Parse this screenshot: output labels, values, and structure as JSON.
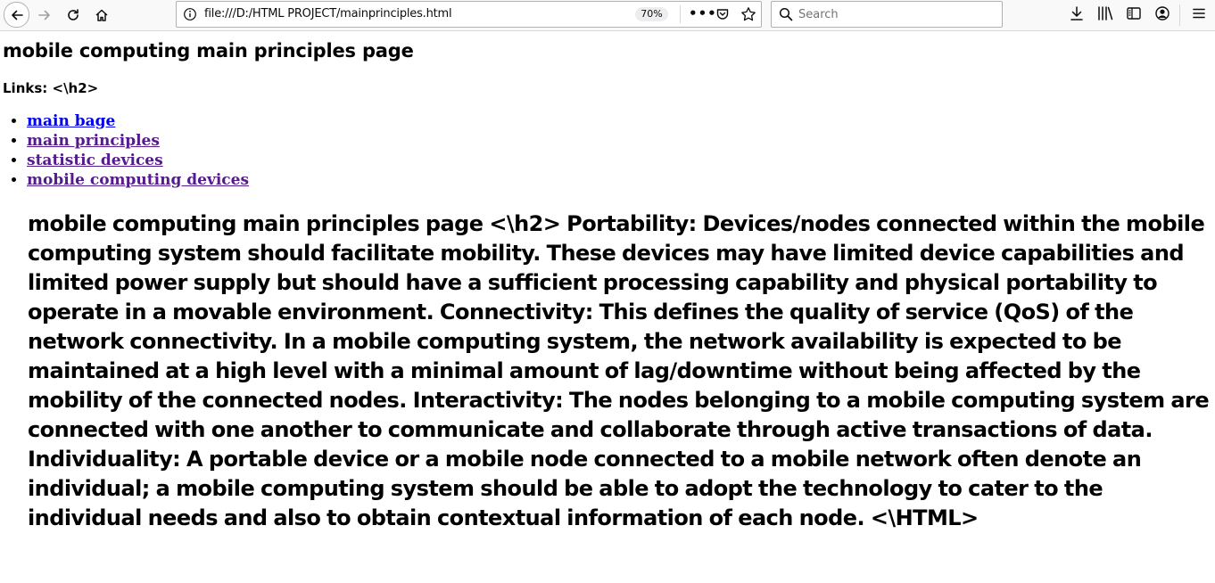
{
  "browser": {
    "url": "file:///D:/HTML PROJECT/mainprinciples.html",
    "zoom": "70%",
    "search_placeholder": "Search",
    "icons": {
      "back": "back-arrow-icon",
      "forward": "forward-arrow-icon",
      "reload": "reload-icon",
      "home": "home-icon",
      "info": "info-icon",
      "more": "more-icon",
      "pocket": "pocket-icon",
      "bookmark": "star-icon",
      "search": "search-icon",
      "download": "download-icon",
      "library": "library-icon",
      "sidebar": "sidebar-icon",
      "account": "account-icon",
      "menu": "hamburger-menu-icon"
    }
  },
  "page": {
    "heading": "mobile computing main principles page",
    "links_label": "Links: <\\h2>",
    "links": [
      {
        "label": "main bage",
        "visited": false
      },
      {
        "label": "main principles",
        "visited": true
      },
      {
        "label": "statistic devices",
        "visited": true
      },
      {
        "label": "mobile computing devices",
        "visited": true
      }
    ],
    "body_text": "mobile computing main principles page <\\h2> Portability: Devices/nodes connected within the mobile computing system should facilitate mobility. These devices may have limited device capabilities and limited power supply but should have a sufficient processing capability and physical portability to operate in a movable environment. Connectivity: This defines the quality of service (QoS) of the network connectivity. In a mobile computing system, the network availability is expected to be maintained at a high level with a minimal amount of lag/downtime without being affected by the mobility of the connected nodes. Interactivity: The nodes belonging to a mobile computing system are connected with one another to communicate and collaborate through active transactions of data. Individuality: A portable device or a mobile node connected to a mobile network often denote an individual; a mobile computing system should be able to adopt the technology to cater to the individual needs and also to obtain contextual information of each node. <\\HTML>"
  },
  "colors": {
    "link_unvisited": "#0000ee",
    "link_visited": "#551a8b",
    "toolbar_bg": "#f9f9fa"
  }
}
